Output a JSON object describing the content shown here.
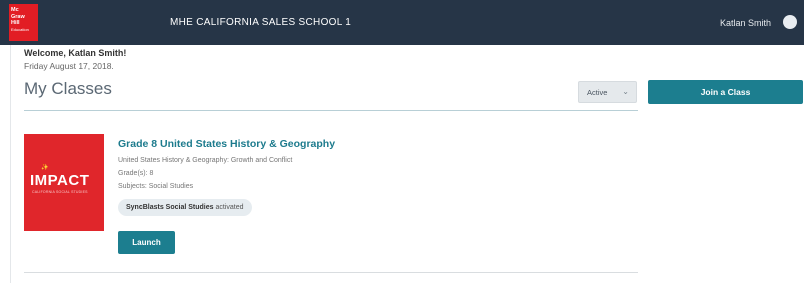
{
  "header": {
    "logo": {
      "line1": "Mc",
      "line2": "Graw",
      "line3": "Hill",
      "line4": "Education"
    },
    "school_name": "MHE CALIFORNIA SALES SCHOOL 1",
    "user_name": "Katlan Smith"
  },
  "welcome": {
    "greeting": "Welcome, Katlan Smith!",
    "date": "Friday August 17, 2018."
  },
  "main": {
    "title": "My Classes",
    "filter": {
      "selected": "Active"
    },
    "join_label": "Join a Class",
    "classes": [
      {
        "cover": {
          "brand": "IMPACT",
          "subtitle": "CALIFORNIA SOCIAL STUDIES"
        },
        "title": "Grade 8 United States History & Geography",
        "subtitle": "United States History & Geography: Growth and Conflict",
        "grade": "Grade(s): 8",
        "subjects": "Subjects: Social Studies",
        "sync": {
          "name": "SyncBlasts Social Studies",
          "status": "activated"
        },
        "launch_label": "Launch"
      }
    ]
  },
  "colors": {
    "header_bg": "#263547",
    "accent": "#1c7e8f",
    "brand_red": "#e0262b"
  }
}
